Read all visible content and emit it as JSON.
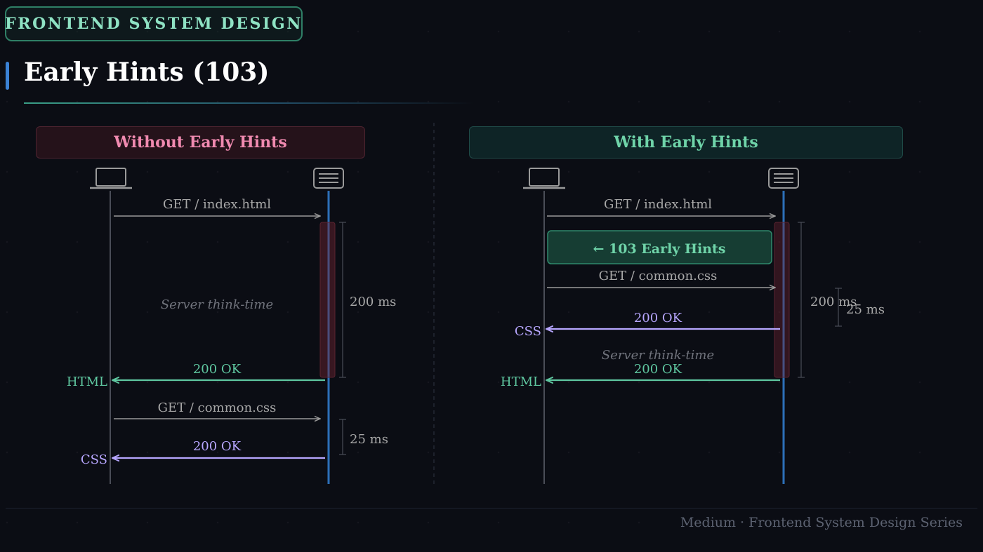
{
  "header": {
    "series_badge": "FRONTEND SYSTEM DESIGN",
    "title": "Early Hints (103)"
  },
  "panels": {
    "left": {
      "title": "Without Early Hints",
      "get_index": "GET / index.html",
      "think_time": "Server think-time",
      "think_duration": "200 ms",
      "html_status": "200 OK",
      "html_label": "HTML",
      "get_css": "GET / common.css",
      "css_duration": "25 ms",
      "css_status": "200 OK",
      "css_label": "CSS"
    },
    "right": {
      "title": "With Early Hints",
      "get_index": "GET / index.html",
      "early_hints": "← 103 Early Hints",
      "get_css": "GET / common.css",
      "css_status": "200 OK",
      "css_label": "CSS",
      "think_duration": "200 ms",
      "css_duration": "25 ms",
      "think_time": "Server think-time",
      "html_status": "200 OK",
      "html_label": "HTML"
    }
  },
  "footer": {
    "credit": "Medium · Frontend System Design Series"
  },
  "icons": {
    "client": "laptop-icon",
    "server": "server-icon"
  },
  "colors": {
    "request": "#9a9a9a",
    "html_response": "#5fc7a0",
    "css_response": "#b7a6ff",
    "server_lifeline": "#2c6fb8",
    "early_hints": "#6fd4a9",
    "think_highlight": "#5a2430"
  }
}
